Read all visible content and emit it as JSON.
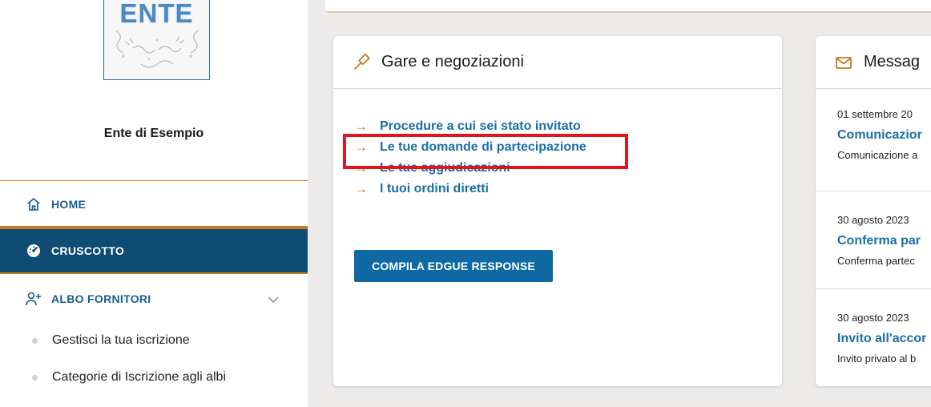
{
  "sidebar": {
    "logo_text": "ENTE",
    "ente_name": "Ente di Esempio",
    "nav": {
      "home": "HOME",
      "cruscotto": "CRUSCOTTO",
      "albo": "ALBO FORNITORI"
    },
    "sub_items": [
      "Gestisci la tua iscrizione",
      "Categorie di Iscrizione agli albi"
    ]
  },
  "gare_card": {
    "title": "Gare e negoziazioni",
    "links": [
      "Procedure a cui sei stato invitato",
      "Le tue domande di partecipazione",
      "Le tue aggiudicazioni",
      "I tuoi ordini diretti"
    ],
    "button_label": "COMPILA EDGUE RESPONSE"
  },
  "messages_card": {
    "title": "Messag",
    "items": [
      {
        "date": "01 settembre 20",
        "title": "Comunicazior",
        "desc": "Comunicazione a"
      },
      {
        "date": "30 agosto 2023",
        "title": "Conferma par",
        "desc": "Conferma partec"
      },
      {
        "date": "30 agosto 2023",
        "title": "Invito all'accor",
        "desc": "Invito privato al b"
      }
    ]
  },
  "colors": {
    "accent_orange": "#c97a1d",
    "nav_active_bg": "#0f4c73",
    "link_blue": "#1a6fa5",
    "highlight_red": "#e3141b"
  }
}
